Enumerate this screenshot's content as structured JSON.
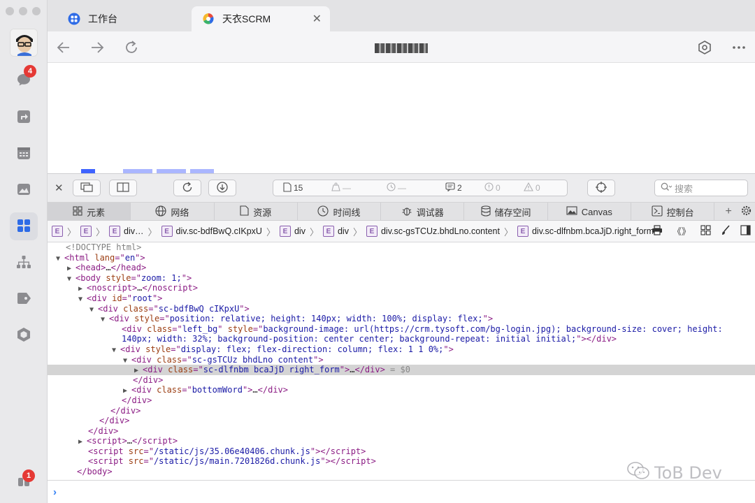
{
  "rail": {
    "chat_badge": "4",
    "bottom_badge": "1"
  },
  "tabs": [
    {
      "label": "工作台"
    },
    {
      "label": "天衣SCRM"
    }
  ],
  "devtools": {
    "counts": {
      "resources": "15",
      "network": "—",
      "timeline": "—",
      "messages": "2",
      "errors": "0",
      "warnings": "0"
    },
    "search_placeholder": "搜索",
    "tabs": [
      "元素",
      "网络",
      "资源",
      "时间线",
      "调试器",
      "储存空间",
      "Canvas",
      "控制台"
    ],
    "breadcrumbs": [
      "div…",
      "div.sc-bdfBwQ.cIKpxU",
      "div",
      "div",
      "div.sc-gsTCUz.bhdLno.content",
      "div.sc-dlfnbm.bcaJjD.right_form"
    ]
  },
  "dom": {
    "doctype": "<!DOCTYPE html>",
    "html_lang": "en",
    "body_style": "zoom: 1;",
    "root_id": "root",
    "outer_class": "sc-bdfBwQ cIKpxU",
    "flex_style": "position: relative; height: 140px; width: 100%; display: flex;",
    "left_bg_class": "left_bg",
    "left_bg_style_1": "background-image: url(https://crm.tysoft.com/bg-login.jpg); background-size: cover; height:",
    "left_bg_style_2": "140px; width: 32%; background-position: center center; background-repeat: initial initial;",
    "column_style": "display: flex; flex-direction: column; flex: 1 1 0%;",
    "content_class": "sc-gsTCUz bhdLno content",
    "selected_class": "sc-dlfnbm bcaJjD right_form",
    "selected_marker": "= $0",
    "bottom_class": "bottomWord",
    "script_src_1": "/static/js/35.06e40406.chunk.js",
    "script_src_2": "/static/js/main.7201826d.chunk.js"
  },
  "watermark": "ToB Dev"
}
